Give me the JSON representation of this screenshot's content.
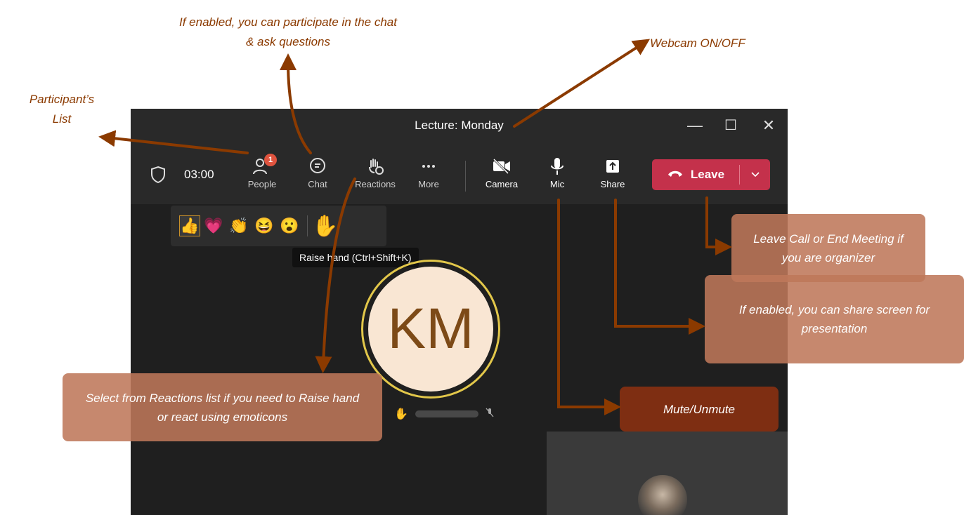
{
  "window": {
    "title": "Lecture: Monday",
    "controls": {
      "minimize": "—",
      "maximize": "☐",
      "close": "✕"
    }
  },
  "toolbar": {
    "timer": "03:00",
    "people_label": "People",
    "people_badge": "1",
    "chat_label": "Chat",
    "reactions_label": "Reactions",
    "more_label": "More",
    "camera_label": "Camera",
    "mic_label": "Mic",
    "share_label": "Share",
    "leave_label": "Leave"
  },
  "reactions_bar": {
    "items": [
      "👍",
      "💗",
      "👏",
      "😆",
      "😮",
      "✋"
    ],
    "tooltip": "Raise hand (Ctrl+Shift+K)"
  },
  "stage": {
    "avatar_initials": "KM",
    "raised_hand_icon": "✋"
  },
  "annotations": {
    "participants_list": "Participant’s List",
    "chat": "If enabled, you can participate in the chat & ask questions",
    "webcam": "Webcam ON/OFF",
    "leave": "Leave Call or End Meeting if you are organizer",
    "share": "If enabled, you can share screen for presentation",
    "mute": "Mute/Unmute",
    "reactions": "Select from Reactions list if you need to Raise hand or react using emoticons"
  },
  "colors": {
    "annotation_text": "#8b3a00",
    "arrow": "#8b3a00",
    "leave_button": "#c4314b",
    "window_bg": "#1f1f1f",
    "toolbar_bg": "#292929"
  }
}
